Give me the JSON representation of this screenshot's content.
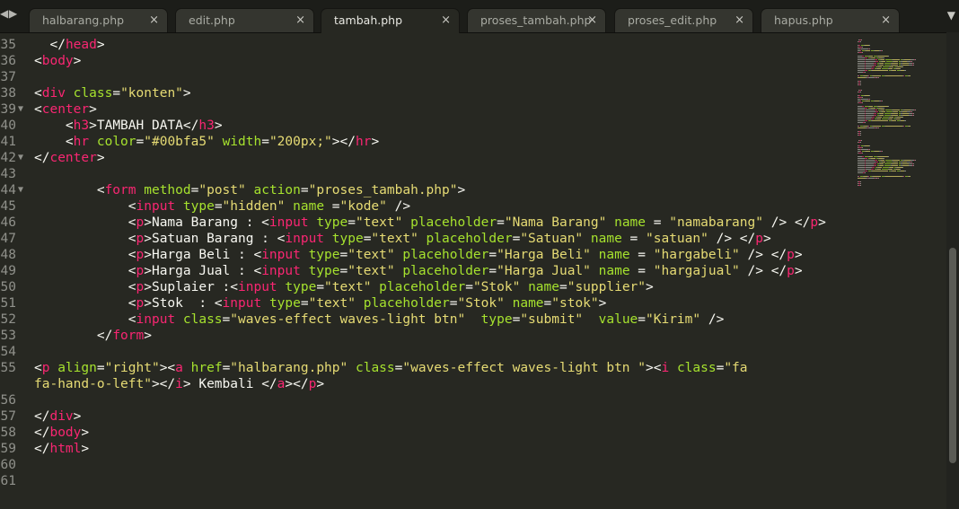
{
  "tabs": [
    {
      "label": "halbarang.php",
      "active": false
    },
    {
      "label": "edit.php",
      "active": false
    },
    {
      "label": "tambah.php",
      "active": true
    },
    {
      "label": "proses_tambah.php",
      "active": false
    },
    {
      "label": "proses_edit.php",
      "active": false
    },
    {
      "label": "hapus.php",
      "active": false
    }
  ],
  "icons": {
    "nav_prev": "◀",
    "nav_next": "▶",
    "close": "×",
    "menu": "▼",
    "fold": "▼"
  },
  "colors": {
    "background": "#272822",
    "tag": "#f92672",
    "attribute": "#a6e22e",
    "string": "#e6db74",
    "text": "#f8f8f2",
    "gutter": "#90918b"
  },
  "lines": [
    {
      "num": "35",
      "fold": false,
      "tokens": [
        [
          "p",
          "  "
        ],
        [
          "p",
          "</"
        ],
        [
          "t",
          "head"
        ],
        [
          "p",
          ">"
        ]
      ]
    },
    {
      "num": "36",
      "fold": false,
      "tokens": [
        [
          "p",
          "<"
        ],
        [
          "t",
          "body"
        ],
        [
          "p",
          ">"
        ]
      ]
    },
    {
      "num": "37",
      "fold": false,
      "tokens": []
    },
    {
      "num": "38",
      "fold": false,
      "tokens": [
        [
          "p",
          "<"
        ],
        [
          "t",
          "div"
        ],
        [
          "p",
          " "
        ],
        [
          "a",
          "class"
        ],
        [
          "p",
          "="
        ],
        [
          "s",
          "\"konten\""
        ],
        [
          "p",
          ">"
        ]
      ]
    },
    {
      "num": "39",
      "fold": true,
      "tokens": [
        [
          "p",
          "<"
        ],
        [
          "t",
          "center"
        ],
        [
          "p",
          ">"
        ]
      ]
    },
    {
      "num": "40",
      "fold": false,
      "tokens": [
        [
          "p",
          "    <"
        ],
        [
          "t",
          "h3"
        ],
        [
          "p",
          ">TAMBAH DATA</"
        ],
        [
          "t",
          "h3"
        ],
        [
          "p",
          ">"
        ]
      ]
    },
    {
      "num": "41",
      "fold": false,
      "tokens": [
        [
          "p",
          "    <"
        ],
        [
          "t",
          "hr"
        ],
        [
          "p",
          " "
        ],
        [
          "a",
          "color"
        ],
        [
          "p",
          "="
        ],
        [
          "s",
          "\"#00bfa5\""
        ],
        [
          "p",
          " "
        ],
        [
          "a",
          "width"
        ],
        [
          "p",
          "="
        ],
        [
          "s",
          "\"200px;\""
        ],
        [
          "p",
          "></"
        ],
        [
          "t",
          "hr"
        ],
        [
          "p",
          ">"
        ]
      ]
    },
    {
      "num": "42",
      "fold": true,
      "tokens": [
        [
          "p",
          "</"
        ],
        [
          "t",
          "center"
        ],
        [
          "p",
          ">"
        ]
      ]
    },
    {
      "num": "43",
      "fold": false,
      "tokens": []
    },
    {
      "num": "44",
      "fold": true,
      "tokens": [
        [
          "p",
          "        <"
        ],
        [
          "t",
          "form"
        ],
        [
          "p",
          " "
        ],
        [
          "a",
          "method"
        ],
        [
          "p",
          "="
        ],
        [
          "s",
          "\"post\""
        ],
        [
          "p",
          " "
        ],
        [
          "a",
          "action"
        ],
        [
          "p",
          "="
        ],
        [
          "s",
          "\"proses_tambah.php\""
        ],
        [
          "p",
          ">"
        ]
      ]
    },
    {
      "num": "45",
      "fold": false,
      "tokens": [
        [
          "p",
          "            <"
        ],
        [
          "t",
          "input"
        ],
        [
          "p",
          " "
        ],
        [
          "a",
          "type"
        ],
        [
          "p",
          "="
        ],
        [
          "s",
          "\"hidden\""
        ],
        [
          "p",
          " "
        ],
        [
          "a",
          "name"
        ],
        [
          "p",
          " ="
        ],
        [
          "s",
          "\"kode\""
        ],
        [
          "p",
          " />"
        ]
      ]
    },
    {
      "num": "46",
      "fold": false,
      "tokens": [
        [
          "p",
          "            <"
        ],
        [
          "t",
          "p"
        ],
        [
          "p",
          ">Nama Barang : <"
        ],
        [
          "t",
          "input"
        ],
        [
          "p",
          " "
        ],
        [
          "a",
          "type"
        ],
        [
          "p",
          "="
        ],
        [
          "s",
          "\"text\""
        ],
        [
          "p",
          " "
        ],
        [
          "a",
          "placeholder"
        ],
        [
          "p",
          "="
        ],
        [
          "s",
          "\"Nama Barang\""
        ],
        [
          "p",
          " "
        ],
        [
          "a",
          "name"
        ],
        [
          "p",
          " = "
        ],
        [
          "s",
          "\"namabarang\""
        ],
        [
          "p",
          " /> </"
        ],
        [
          "t",
          "p"
        ],
        [
          "p",
          ">"
        ]
      ]
    },
    {
      "num": "47",
      "fold": false,
      "tokens": [
        [
          "p",
          "            <"
        ],
        [
          "t",
          "p"
        ],
        [
          "p",
          ">Satuan Barang : <"
        ],
        [
          "t",
          "input"
        ],
        [
          "p",
          " "
        ],
        [
          "a",
          "type"
        ],
        [
          "p",
          "="
        ],
        [
          "s",
          "\"text\""
        ],
        [
          "p",
          " "
        ],
        [
          "a",
          "placeholder"
        ],
        [
          "p",
          "="
        ],
        [
          "s",
          "\"Satuan\""
        ],
        [
          "p",
          " "
        ],
        [
          "a",
          "name"
        ],
        [
          "p",
          " = "
        ],
        [
          "s",
          "\"satuan\""
        ],
        [
          "p",
          " /> </"
        ],
        [
          "t",
          "p"
        ],
        [
          "p",
          ">"
        ]
      ]
    },
    {
      "num": "48",
      "fold": false,
      "tokens": [
        [
          "p",
          "            <"
        ],
        [
          "t",
          "p"
        ],
        [
          "p",
          ">Harga Beli : <"
        ],
        [
          "t",
          "input"
        ],
        [
          "p",
          " "
        ],
        [
          "a",
          "type"
        ],
        [
          "p",
          "="
        ],
        [
          "s",
          "\"text\""
        ],
        [
          "p",
          " "
        ],
        [
          "a",
          "placeholder"
        ],
        [
          "p",
          "="
        ],
        [
          "s",
          "\"Harga Beli\""
        ],
        [
          "p",
          " "
        ],
        [
          "a",
          "name"
        ],
        [
          "p",
          " = "
        ],
        [
          "s",
          "\"hargabeli\""
        ],
        [
          "p",
          " /> </"
        ],
        [
          "t",
          "p"
        ],
        [
          "p",
          ">"
        ]
      ]
    },
    {
      "num": "49",
      "fold": false,
      "tokens": [
        [
          "p",
          "            <"
        ],
        [
          "t",
          "p"
        ],
        [
          "p",
          ">Harga Jual : <"
        ],
        [
          "t",
          "input"
        ],
        [
          "p",
          " "
        ],
        [
          "a",
          "type"
        ],
        [
          "p",
          "="
        ],
        [
          "s",
          "\"text\""
        ],
        [
          "p",
          " "
        ],
        [
          "a",
          "placeholder"
        ],
        [
          "p",
          "="
        ],
        [
          "s",
          "\"Harga Jual\""
        ],
        [
          "p",
          " "
        ],
        [
          "a",
          "name"
        ],
        [
          "p",
          " = "
        ],
        [
          "s",
          "\"hargajual\""
        ],
        [
          "p",
          " /> </"
        ],
        [
          "t",
          "p"
        ],
        [
          "p",
          ">"
        ]
      ]
    },
    {
      "num": "50",
      "fold": false,
      "tokens": [
        [
          "p",
          "            <"
        ],
        [
          "t",
          "p"
        ],
        [
          "p",
          ">Suplaier :<"
        ],
        [
          "t",
          "input"
        ],
        [
          "p",
          " "
        ],
        [
          "a",
          "type"
        ],
        [
          "p",
          "="
        ],
        [
          "s",
          "\"text\""
        ],
        [
          "p",
          " "
        ],
        [
          "a",
          "placeholder"
        ],
        [
          "p",
          "="
        ],
        [
          "s",
          "\"Stok\""
        ],
        [
          "p",
          " "
        ],
        [
          "a",
          "name"
        ],
        [
          "p",
          "="
        ],
        [
          "s",
          "\"supplier\""
        ],
        [
          "p",
          ">"
        ]
      ]
    },
    {
      "num": "51",
      "fold": false,
      "tokens": [
        [
          "p",
          "            <"
        ],
        [
          "t",
          "p"
        ],
        [
          "p",
          ">Stok  : <"
        ],
        [
          "t",
          "input"
        ],
        [
          "p",
          " "
        ],
        [
          "a",
          "type"
        ],
        [
          "p",
          "="
        ],
        [
          "s",
          "\"text\""
        ],
        [
          "p",
          " "
        ],
        [
          "a",
          "placeholder"
        ],
        [
          "p",
          "="
        ],
        [
          "s",
          "\"Stok\""
        ],
        [
          "p",
          " "
        ],
        [
          "a",
          "name"
        ],
        [
          "p",
          "="
        ],
        [
          "s",
          "\"stok\""
        ],
        [
          "p",
          ">"
        ]
      ]
    },
    {
      "num": "52",
      "fold": false,
      "tokens": [
        [
          "p",
          "            <"
        ],
        [
          "t",
          "input"
        ],
        [
          "p",
          " "
        ],
        [
          "a",
          "class"
        ],
        [
          "p",
          "="
        ],
        [
          "s",
          "\"waves-effect waves-light btn\""
        ],
        [
          "p",
          "  "
        ],
        [
          "a",
          "type"
        ],
        [
          "p",
          "="
        ],
        [
          "s",
          "\"submit\""
        ],
        [
          "p",
          "  "
        ],
        [
          "a",
          "value"
        ],
        [
          "p",
          "="
        ],
        [
          "s",
          "\"Kirim\""
        ],
        [
          "p",
          " />"
        ]
      ]
    },
    {
      "num": "53",
      "fold": false,
      "tokens": [
        [
          "p",
          "        </"
        ],
        [
          "t",
          "form"
        ],
        [
          "p",
          ">"
        ]
      ]
    },
    {
      "num": "54",
      "fold": false,
      "tokens": []
    },
    {
      "num": "55",
      "fold": false,
      "tokens": [
        [
          "p",
          "<"
        ],
        [
          "t",
          "p"
        ],
        [
          "p",
          " "
        ],
        [
          "a",
          "align"
        ],
        [
          "p",
          "="
        ],
        [
          "s",
          "\"right\""
        ],
        [
          "p",
          "><"
        ],
        [
          "t",
          "a"
        ],
        [
          "p",
          " "
        ],
        [
          "a",
          "href"
        ],
        [
          "p",
          "="
        ],
        [
          "s",
          "\"halbarang.php\""
        ],
        [
          "p",
          " "
        ],
        [
          "a",
          "class"
        ],
        [
          "p",
          "="
        ],
        [
          "s",
          "\"waves-effect waves-light btn \""
        ],
        [
          "p",
          "><"
        ],
        [
          "t",
          "i"
        ],
        [
          "p",
          " "
        ],
        [
          "a",
          "class"
        ],
        [
          "p",
          "="
        ],
        [
          "s",
          "\"fa"
        ]
      ]
    },
    {
      "num": "",
      "fold": false,
      "tokens": [
        [
          "s",
          "fa-hand-o-left\""
        ],
        [
          "p",
          "></"
        ],
        [
          "t",
          "i"
        ],
        [
          "p",
          "> Kembali </"
        ],
        [
          "t",
          "a"
        ],
        [
          "p",
          "></"
        ],
        [
          "t",
          "p"
        ],
        [
          "p",
          ">"
        ]
      ]
    },
    {
      "num": "56",
      "fold": false,
      "tokens": []
    },
    {
      "num": "57",
      "fold": false,
      "tokens": [
        [
          "p",
          "</"
        ],
        [
          "t",
          "div"
        ],
        [
          "p",
          ">"
        ]
      ]
    },
    {
      "num": "58",
      "fold": false,
      "tokens": [
        [
          "p",
          "</"
        ],
        [
          "t",
          "body"
        ],
        [
          "p",
          ">"
        ]
      ]
    },
    {
      "num": "59",
      "fold": false,
      "tokens": [
        [
          "p",
          "</"
        ],
        [
          "t",
          "html"
        ],
        [
          "p",
          ">"
        ]
      ]
    },
    {
      "num": "60",
      "fold": false,
      "tokens": []
    },
    {
      "num": "61",
      "fold": false,
      "tokens": []
    }
  ]
}
